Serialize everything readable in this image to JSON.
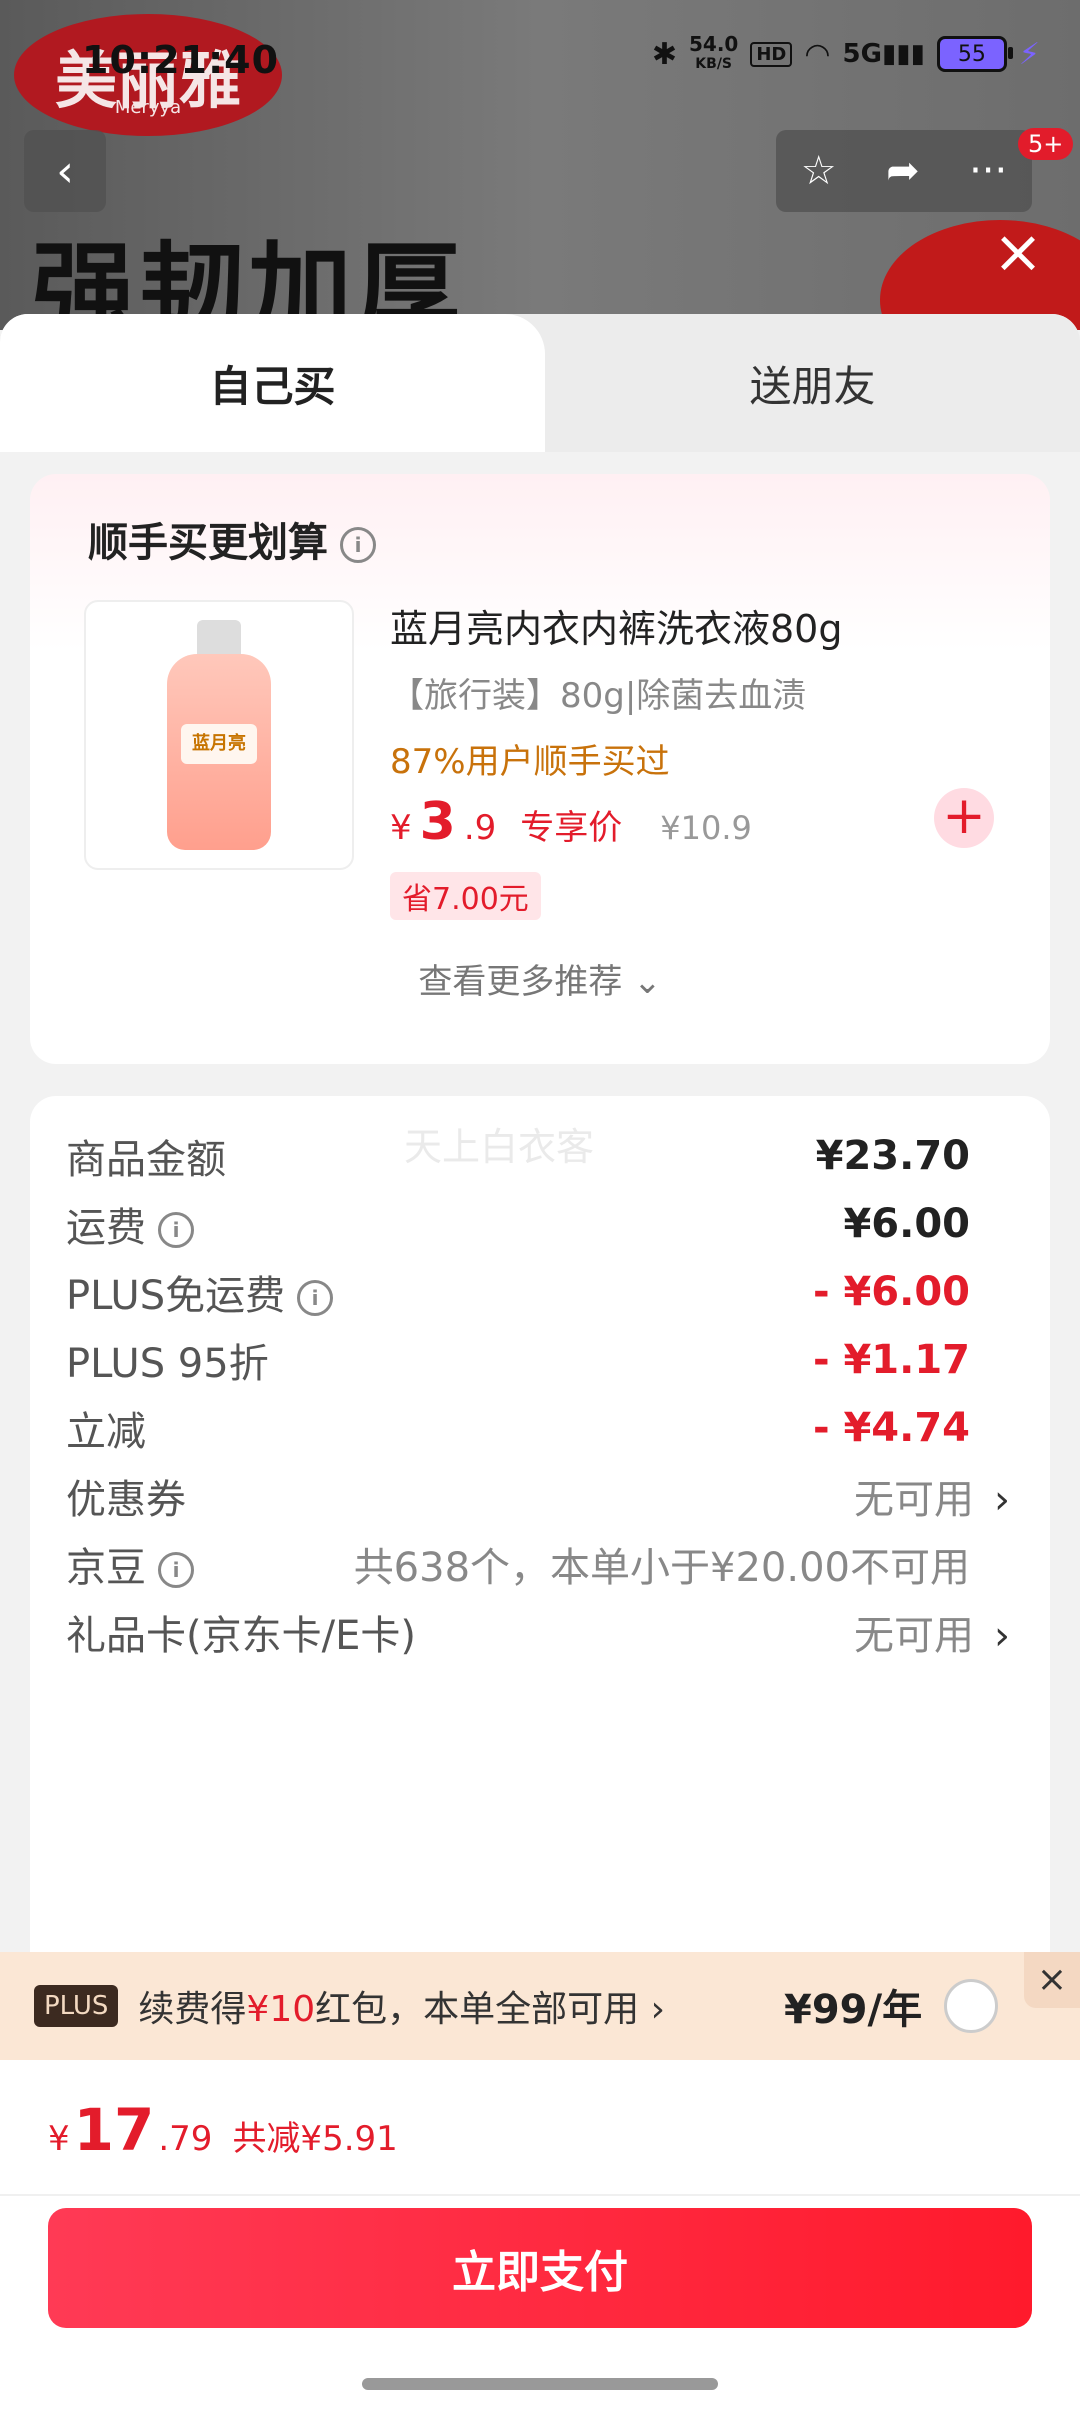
{
  "status": {
    "time": "10:21:40",
    "net_speed": "54.0",
    "net_unit": "KB/S",
    "hd": "HD",
    "signal": "5G",
    "battery": "55"
  },
  "background": {
    "brand_logo": "美丽雅",
    "brand_logo_sub": "Meryya",
    "banner_text": "强韧加厚"
  },
  "nav": {
    "notification_count": "5+"
  },
  "tabs": {
    "self": "自己买",
    "gift": "送朋友"
  },
  "reco": {
    "title": "顺手买更划算",
    "product": {
      "name": "蓝月亮内衣内裤洗衣液80g",
      "desc": "【旅行装】80g|除菌去血渍",
      "bought": "87%用户顺手买过",
      "price_symbol": "¥",
      "price_int": "3",
      "price_dec": ".9",
      "price_tag": "专享价",
      "orig_price": "¥10.9",
      "save": "省7.00元",
      "image_label": "蓝月亮"
    },
    "more": "查看更多推荐 ⌄"
  },
  "summary": {
    "watermark": "天上白衣客",
    "rows": [
      {
        "label": "商品金额",
        "value": "¥23.70"
      },
      {
        "label": "运费",
        "value": "¥6.00"
      },
      {
        "label": "PLUS免运费",
        "value": "- ¥6.00"
      },
      {
        "label": "PLUS 95折",
        "value": "- ¥1.17"
      },
      {
        "label": "立减",
        "value": "- ¥4.74"
      },
      {
        "label": "优惠券",
        "value": "无可用"
      },
      {
        "label": "京豆",
        "value": "共638个，本单小于¥20.00不可用"
      },
      {
        "label": "礼品卡(京东卡/E卡)",
        "value": "无可用"
      }
    ]
  },
  "plus": {
    "badge": "PLUS",
    "text_pre": "续费得",
    "text_red": "¥10",
    "text_post": "红包，本单全部可用 ›",
    "price": "¥99/年"
  },
  "pay": {
    "symbol": "¥",
    "int": "17",
    "dec": ".79",
    "cut": "共减¥5.91",
    "button": "立即支付"
  }
}
